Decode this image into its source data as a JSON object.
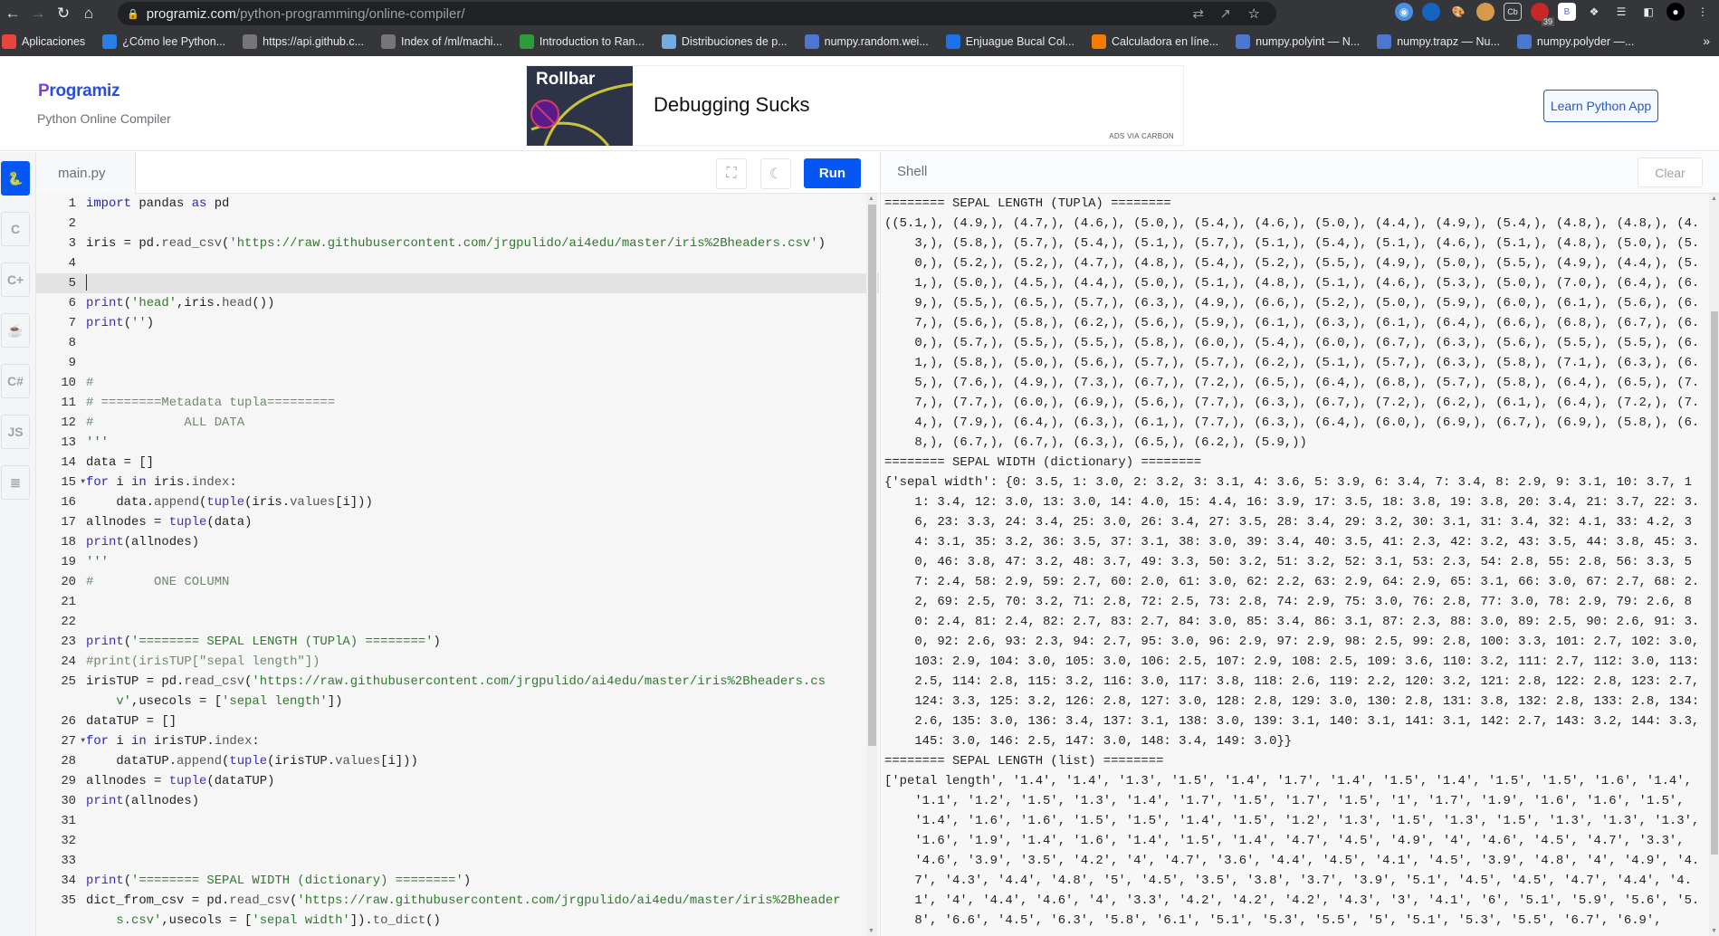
{
  "browser": {
    "url_host": "programiz.com",
    "url_path": "/python-programming/online-compiler/",
    "bookmarks": [
      {
        "label": "Aplicaciones",
        "icon": "apps-grid-icon",
        "color": "#e8453c"
      },
      {
        "label": "¿Cómo lee Python...",
        "icon": "pycharm-icon",
        "color": "#2b7de9"
      },
      {
        "label": "https://api.github.c...",
        "icon": "globe-icon",
        "color": "#777"
      },
      {
        "label": "Index of /ml/machi...",
        "icon": "globe-icon",
        "color": "#777"
      },
      {
        "label": "Introduction to Ran...",
        "icon": "w-icon",
        "color": "#2e9b3a"
      },
      {
        "label": "Distribuciones de p...",
        "icon": "flag-icon",
        "color": "#74acdf"
      },
      {
        "label": "numpy.random.wei...",
        "icon": "numpy-icon",
        "color": "#4d77cf"
      },
      {
        "label": "Enjuague Bucal Col...",
        "icon": "key-icon",
        "color": "#1a73e8"
      },
      {
        "label": "Calculadora en líne...",
        "icon": "calculator-icon",
        "color": "#f57c00"
      },
      {
        "label": "numpy.polyint — N...",
        "icon": "numpy-icon",
        "color": "#4d77cf"
      },
      {
        "label": "numpy.trapz — Nu...",
        "icon": "numpy-icon",
        "color": "#4d77cf"
      },
      {
        "label": "numpy.polyder —...",
        "icon": "numpy-icon",
        "color": "#4d77cf"
      }
    ],
    "ext_badge": "39"
  },
  "header": {
    "logo_text": "rogramiz",
    "logo_p": "P",
    "subtitle": "Python Online Compiler",
    "ad_brand": "Rollbar",
    "ad_title": "Debugging Sucks",
    "ad_via": "ADS VIA CARBON",
    "learn_button": "Learn Python App"
  },
  "sidebar": [
    "python",
    "c",
    "cpp",
    "java",
    "csharp",
    "JS",
    "sql"
  ],
  "editor": {
    "tab": "main.py",
    "run": "Run",
    "active_line": 5,
    "fold_lines": [
      15,
      27
    ],
    "lines": [
      "import pandas as pd",
      "",
      "iris = pd.read_csv('https://raw.githubusercontent.com/jrgpulido/ai4edu/master/iris%2Bheaders.csv')",
      "",
      "",
      "print('head',iris.head())",
      "print('')",
      "",
      "",
      "#",
      "# ========Metadata tupla=========",
      "#            ALL DATA",
      "'''",
      "data = []",
      "for i in iris.index:",
      "    data.append(tuple(iris.values[i]))",
      "allnodes = tuple(data)",
      "print(allnodes)",
      "'''",
      "#        ONE COLUMN",
      "",
      "",
      "print('======== SEPAL LENGTH (TUPlA) ========')",
      "#print(irisTUP[\"sepal length\"])",
      "irisTUP = pd.read_csv('https://raw.githubusercontent.com/jrgpulido/ai4edu/master/iris%2Bheaders.csv',usecols = ['sepal length'])",
      "dataTUP = []",
      "for i in irisTUP.index:",
      "    dataTUP.append(tuple(irisTUP.values[i]))",
      "allnodes = tuple(dataTUP)",
      "print(allnodes)",
      "",
      "",
      "",
      "print('======== SEPAL WIDTH (dictionary) ========')",
      "dict_from_csv = pd.read_csv('https://raw.githubusercontent.com/jrgpulido/ai4edu/master/iris%2Bheaders.csv',usecols = ['sepal width']).to_dict()"
    ]
  },
  "shell": {
    "label": "Shell",
    "clear": "Clear",
    "output": [
      "======== SEPAL LENGTH (TUPlA) ========",
      "((5.1,), (4.9,), (4.7,), (4.6,), (5.0,), (5.4,), (4.6,), (5.0,), (4.4,), (4.9,), (5.4,), (4.8,), (4.8,), (4.3,), (5.8,), (5.7,), (5.4,), (5.1,), (5.7,), (5.1,), (5.4,), (5.1,), (4.6,), (5.1,), (4.8,), (5.0,), (5.0,), (5.2,), (5.2,), (4.7,), (4.8,), (5.4,), (5.2,), (5.5,), (4.9,), (5.0,), (5.5,), (4.9,), (4.4,), (5.1,), (5.0,), (4.5,), (4.4,), (5.0,), (5.1,), (4.8,), (5.1,), (4.6,), (5.3,), (5.0,), (7.0,), (6.4,), (6.9,), (5.5,), (6.5,), (5.7,), (6.3,), (4.9,), (6.6,), (5.2,), (5.0,), (5.9,), (6.0,), (6.1,), (5.6,), (6.7,), (5.6,), (5.8,), (6.2,), (5.6,), (5.9,), (6.1,), (6.3,), (6.1,), (6.4,), (6.6,), (6.8,), (6.7,), (6.0,), (5.7,), (5.5,), (5.5,), (5.8,), (6.0,), (5.4,), (6.0,), (6.7,), (6.3,), (5.6,), (5.5,), (5.5,), (6.1,), (5.8,), (5.0,), (5.6,), (5.7,), (5.7,), (6.2,), (5.1,), (5.7,), (6.3,), (5.8,), (7.1,), (6.3,), (6.5,), (7.6,), (4.9,), (7.3,), (6.7,), (7.2,), (6.5,), (6.4,), (6.8,), (5.7,), (5.8,), (6.4,), (6.5,), (7.7,), (7.7,), (6.0,), (6.9,), (5.6,), (7.7,), (6.3,), (6.7,), (7.2,), (6.2,), (6.1,), (6.4,), (7.2,), (7.4,), (7.9,), (6.4,), (6.3,), (6.1,), (7.7,), (6.3,), (6.4,), (6.0,), (6.9,), (6.7,), (6.9,), (5.8,), (6.8,), (6.7,), (6.7,), (6.3,), (6.5,), (6.2,), (5.9,))",
      "======== SEPAL WIDTH (dictionary) ========",
      "{'sepal width': {0: 3.5, 1: 3.0, 2: 3.2, 3: 3.1, 4: 3.6, 5: 3.9, 6: 3.4, 7: 3.4, 8: 2.9, 9: 3.1, 10: 3.7, 11: 3.4, 12: 3.0, 13: 3.0, 14: 4.0, 15: 4.4, 16: 3.9, 17: 3.5, 18: 3.8, 19: 3.8, 20: 3.4, 21: 3.7, 22: 3.6, 23: 3.3, 24: 3.4, 25: 3.0, 26: 3.4, 27: 3.5, 28: 3.4, 29: 3.2, 30: 3.1, 31: 3.4, 32: 4.1, 33: 4.2, 34: 3.1, 35: 3.2, 36: 3.5, 37: 3.1, 38: 3.0, 39: 3.4, 40: 3.5, 41: 2.3, 42: 3.2, 43: 3.5, 44: 3.8, 45: 3.0, 46: 3.8, 47: 3.2, 48: 3.7, 49: 3.3, 50: 3.2, 51: 3.2, 52: 3.1, 53: 2.3, 54: 2.8, 55: 2.8, 56: 3.3, 57: 2.4, 58: 2.9, 59: 2.7, 60: 2.0, 61: 3.0, 62: 2.2, 63: 2.9, 64: 2.9, 65: 3.1, 66: 3.0, 67: 2.7, 68: 2.2, 69: 2.5, 70: 3.2, 71: 2.8, 72: 2.5, 73: 2.8, 74: 2.9, 75: 3.0, 76: 2.8, 77: 3.0, 78: 2.9, 79: 2.6, 80: 2.4, 81: 2.4, 82: 2.7, 83: 2.7, 84: 3.0, 85: 3.4, 86: 3.1, 87: 2.3, 88: 3.0, 89: 2.5, 90: 2.6, 91: 3.0, 92: 2.6, 93: 2.3, 94: 2.7, 95: 3.0, 96: 2.9, 97: 2.9, 98: 2.5, 99: 2.8, 100: 3.3, 101: 2.7, 102: 3.0, 103: 2.9, 104: 3.0, 105: 3.0, 106: 2.5, 107: 2.9, 108: 2.5, 109: 3.6, 110: 3.2, 111: 2.7, 112: 3.0, 113: 2.5, 114: 2.8, 115: 3.2, 116: 3.0, 117: 3.8, 118: 2.6, 119: 2.2, 120: 3.2, 121: 2.8, 122: 2.8, 123: 2.7, 124: 3.3, 125: 3.2, 126: 2.8, 127: 3.0, 128: 2.8, 129: 3.0, 130: 2.8, 131: 3.8, 132: 2.8, 133: 2.8, 134: 2.6, 135: 3.0, 136: 3.4, 137: 3.1, 138: 3.0, 139: 3.1, 140: 3.1, 141: 3.1, 142: 2.7, 143: 3.2, 144: 3.3, 145: 3.0, 146: 2.5, 147: 3.0, 148: 3.4, 149: 3.0}}",
      "======== SEPAL LENGTH (list) ========",
      "['petal length', '1.4', '1.4', '1.3', '1.5', '1.4', '1.7', '1.4', '1.5', '1.4', '1.5', '1.5', '1.6', '1.4', '1.1', '1.2', '1.5', '1.3', '1.4', '1.7', '1.5', '1.7', '1.5', '1', '1.7', '1.9', '1.6', '1.6', '1.5', '1.4', '1.6', '1.6', '1.5', '1.5', '1.4', '1.5', '1.2', '1.3', '1.5', '1.3', '1.5', '1.3', '1.3', '1.3', '1.6', '1.9', '1.4', '1.6', '1.4', '1.5', '1.4', '4.7', '4.5', '4.9', '4', '4.6', '4.5', '4.7', '3.3', '4.6', '3.9', '3.5', '4.2', '4', '4.7', '3.6', '4.4', '4.5', '4.1', '4.5', '3.9', '4.8', '4', '4.9', '4.7', '4.3', '4.4', '4.8', '5', '4.5', '3.5', '3.8', '3.7', '3.9', '5.1', '4.5', '4.5', '4.7', '4.4', '4.1', '4', '4.4', '4.6', '4', '3.3', '4.2', '4.2', '4.2', '4.3', '3', '4.1', '6', '5.1', '5.9', '5.6', '5.8', '6.6', '4.5', '6.3', '5.8', '6.1', '5.1', '5.3', '5.5', '5', '5.1', '5.3', '5.5', '6.7', '6.9',"
    ]
  },
  "colors": {
    "accent": "#0556f3",
    "brand": "#2a4fd6"
  }
}
